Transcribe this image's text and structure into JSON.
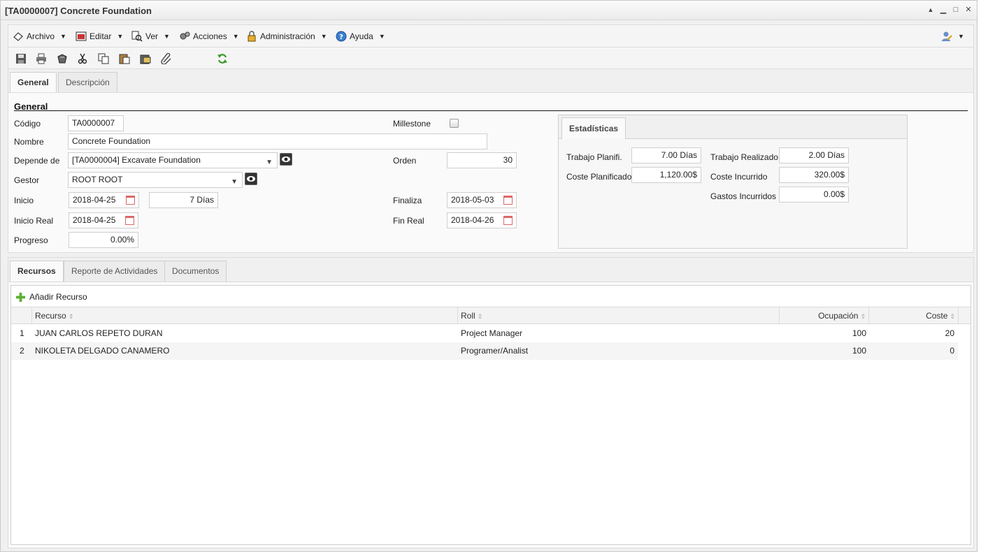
{
  "window": {
    "title": "[TA0000007] Concrete Foundation",
    "controls": {
      "collapse": "▲",
      "minimize": "▁",
      "maximize": "□",
      "close": "✕"
    }
  },
  "menubar": {
    "items": [
      {
        "label": "Archivo",
        "icon": "file-icon"
      },
      {
        "label": "Editar",
        "icon": "edit-icon"
      },
      {
        "label": "Ver",
        "icon": "view-icon"
      },
      {
        "label": "Acciones",
        "icon": "actions-icon"
      },
      {
        "label": "Administración",
        "icon": "lock-icon"
      },
      {
        "label": "Ayuda",
        "icon": "help-icon"
      }
    ],
    "user_icon": "user-settings-icon"
  },
  "toolbar": {
    "buttons": [
      "save-icon",
      "print-icon",
      "delete-icon",
      "cut-icon",
      "copy-icon",
      "paste-icon",
      "paste-special-icon",
      "attach-icon",
      "refresh-icon"
    ]
  },
  "tabs": [
    "General",
    "Descripción"
  ],
  "general": {
    "section_title": "General",
    "codigo": {
      "label": "Código",
      "value": "TA0000007"
    },
    "nombre": {
      "label": "Nombre",
      "value": "Concrete Foundation"
    },
    "depende_de": {
      "label": "Depende de",
      "value": "[TA0000004] Excavate Foundation"
    },
    "gestor": {
      "label": "Gestor",
      "value": "ROOT ROOT"
    },
    "inicio": {
      "label": "Inicio",
      "value": "2018-04-25",
      "duration": "7 Días"
    },
    "inicio_real": {
      "label": "Inicio Real",
      "value": "2018-04-25"
    },
    "progreso": {
      "label": "Progreso",
      "value": "0.00%"
    },
    "millestone": {
      "label": "Millestone"
    },
    "orden": {
      "label": "Orden",
      "value": "30"
    },
    "finaliza": {
      "label": "Finaliza",
      "value": "2018-05-03"
    },
    "fin_real": {
      "label": "Fin Real",
      "value": "2018-04-26"
    }
  },
  "stats": {
    "tab": "Estadísticas",
    "trabajo_planificado": {
      "label": "Trabajo Planifi.",
      "value": "7.00 Días"
    },
    "coste_planificado": {
      "label": "Coste Planificado",
      "value": "1,120.00$"
    },
    "trabajo_realizado": {
      "label": "Trabajo Realizado",
      "value": "2.00 Días"
    },
    "coste_incurrido": {
      "label": "Coste Incurrido",
      "value": "320.00$"
    },
    "gastos_incurridos": {
      "label": "Gastos Incurridos",
      "value": "0.00$"
    }
  },
  "lower_tabs": [
    "Recursos",
    "Reporte de Actividades",
    "Documentos"
  ],
  "grid": {
    "add_label": "Añadir Recurso",
    "columns": [
      "Recurso",
      "Roll",
      "Ocupación",
      "Coste"
    ],
    "rows": [
      {
        "num": "1",
        "recurso": "JUAN CARLOS REPETO DURAN",
        "roll": "Project Manager",
        "ocupacion": "100",
        "coste": "20"
      },
      {
        "num": "2",
        "recurso": "NIKOLETA DELGADO CANAMERO",
        "roll": "Programer/Analist",
        "ocupacion": "100",
        "coste": "0"
      }
    ]
  },
  "colors": {
    "accent_green": "#3a9a2a",
    "calendar_red": "#dd6666"
  }
}
